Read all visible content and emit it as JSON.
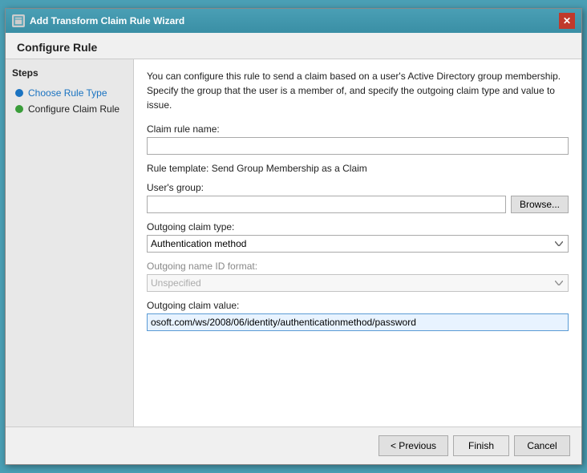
{
  "window": {
    "title": "Add Transform Claim Rule Wizard",
    "close_label": "✕"
  },
  "page": {
    "title": "Configure Rule",
    "description": "You can configure this rule to send a claim based on a user's Active Directory group membership. Specify the group that the user is a member of, and specify the outgoing claim type and value to issue."
  },
  "sidebar": {
    "title": "Steps",
    "items": [
      {
        "label": "Choose Rule Type",
        "status": "inactive",
        "color": "blue"
      },
      {
        "label": "Configure Claim Rule",
        "status": "active",
        "color": "green"
      }
    ]
  },
  "form": {
    "claim_rule_name_label": "Claim rule name:",
    "claim_rule_name_value": "",
    "claim_rule_name_placeholder": "",
    "rule_template_text": "Rule template: Send Group Membership as a Claim",
    "users_group_label": "User's group:",
    "users_group_value": "",
    "browse_label": "Browse...",
    "outgoing_claim_type_label": "Outgoing claim type:",
    "outgoing_claim_type_value": "Authentication method",
    "outgoing_claim_type_options": [
      "Authentication method"
    ],
    "outgoing_name_id_label": "Outgoing name ID format:",
    "outgoing_name_id_value": "Unspecified",
    "outgoing_name_id_options": [
      "Unspecified"
    ],
    "outgoing_claim_value_label": "Outgoing claim value:",
    "outgoing_claim_value_text": "osoft.com/ws/2008/06/identity/authenticationmethod/password"
  },
  "footer": {
    "previous_label": "< Previous",
    "finish_label": "Finish",
    "cancel_label": "Cancel"
  }
}
